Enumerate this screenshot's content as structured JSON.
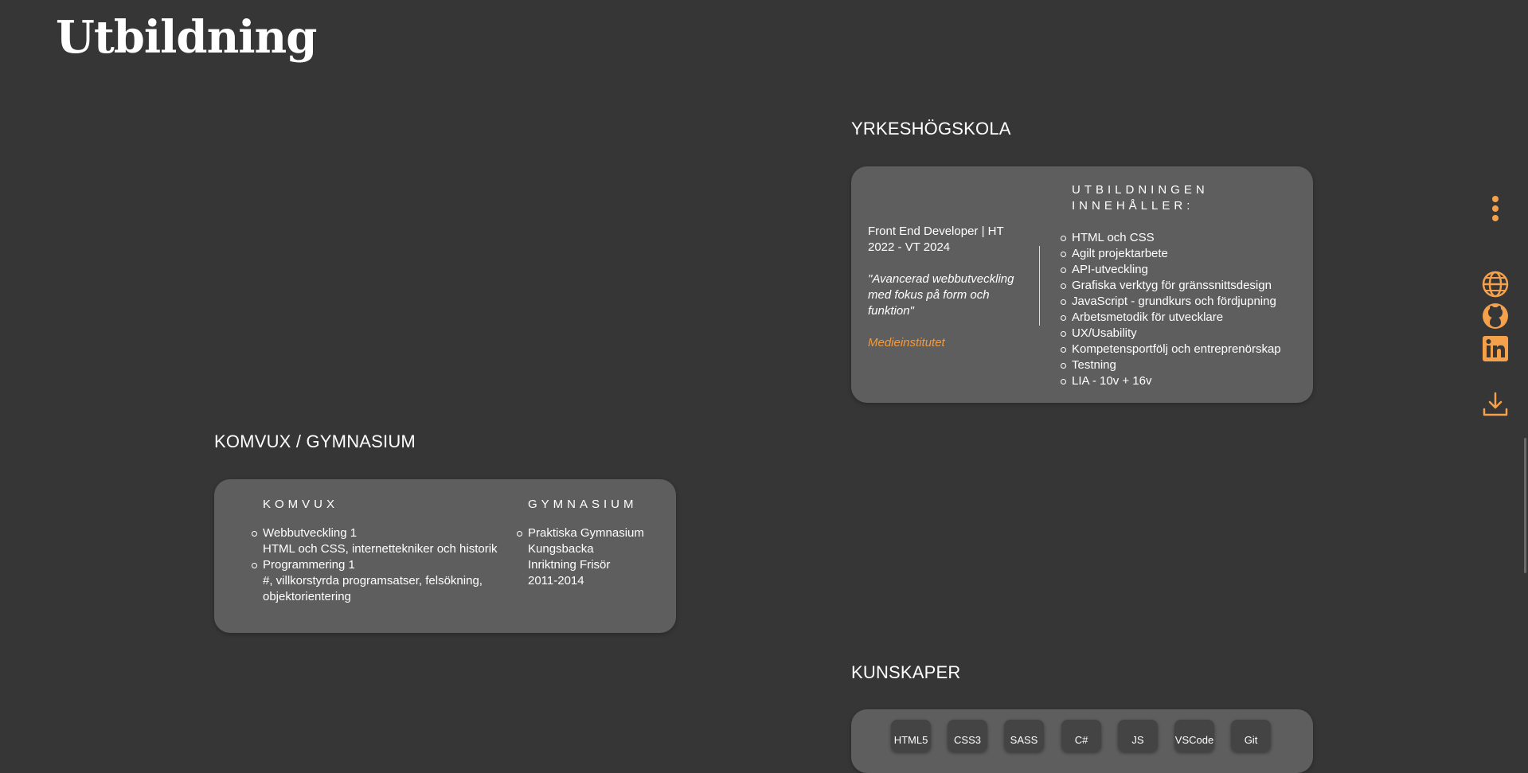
{
  "page": {
    "title": "Utbildning"
  },
  "yrkeshogskola": {
    "heading": "YRKESHÖGSKOLA",
    "program": "Front End Developer | HT 2022 - VT 2024",
    "quote": "\"Avancerad webbutveckling med fokus på form och funktion\"",
    "school": "Medieinstitutet",
    "content_heading": "UTBILDNINGEN INNEHÅLLER:",
    "content_items": [
      "HTML och CSS",
      "Agilt projektarbete",
      "API-utveckling",
      "Grafiska verktyg för gränssnittsdesign",
      "JavaScript - grundkurs och fördjupning",
      "Arbetsmetodik för utvecklare",
      "UX/Usability",
      "Kompetensportfölj och entreprenörskap",
      "Testning",
      "LIA - 10v + 16v"
    ]
  },
  "komvux_gymnasium": {
    "heading": "KOMVUX / GYMNASIUM",
    "komvux": {
      "heading": "KOMVUX",
      "items": [
        {
          "title": "Webbutveckling 1",
          "desc": "HTML och CSS, internettekniker och historik"
        },
        {
          "title": "Programmering 1",
          "desc": "#, villkorstyrda programsatser, felsökning, objektorientering"
        }
      ]
    },
    "gymnasium": {
      "heading": "GYMNASIUM",
      "school": "Praktiska Gymnasium Kungsbacka",
      "track": "Inriktning Frisör",
      "years": "2011-2014"
    }
  },
  "kunskaper": {
    "heading": "KUNSKAPER",
    "skills": [
      "HTML5",
      "CSS3",
      "SASS",
      "C#",
      "JS",
      "VSCode",
      "Git"
    ]
  },
  "sidebar": {
    "icons": [
      "menu-dots-icon",
      "globe-icon",
      "github-icon",
      "linkedin-icon",
      "download-icon"
    ],
    "accent": "#f5a04a"
  },
  "colors": {
    "background": "#363636",
    "card": "#5e5e5e",
    "accent": "#f39a3c"
  }
}
